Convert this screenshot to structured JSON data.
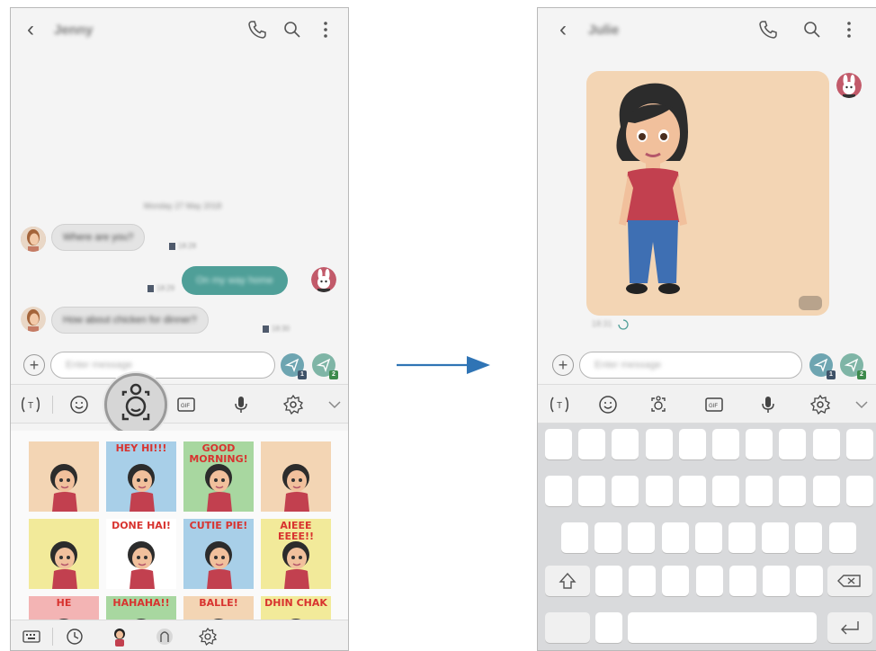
{
  "colors": {
    "accent_teal": "#4f9f98",
    "sticker_peach": "#f3d5b4",
    "arrow_blue": "#2f74b5"
  },
  "left_screen": {
    "contact_name": "Jenny",
    "date_label": "Monday 27 May 2018",
    "messages": [
      {
        "text": "Where are you?",
        "time": "18:28",
        "direction": "incoming"
      },
      {
        "text": "On my way home",
        "time": "18:29",
        "direction": "outgoing"
      },
      {
        "text": "How about chicken for dinner?",
        "time": "18:30",
        "direction": "incoming"
      }
    ],
    "input_placeholder": "Enter message",
    "send_sim1": "1",
    "send_sim2": "2",
    "stickers": [
      {
        "caption": "",
        "bg": "#f3d5b4"
      },
      {
        "caption": "HEY HI!!!",
        "bg": "#a8cfe8"
      },
      {
        "caption": "GOOD MORNING!",
        "bg": "#a8d7a0"
      },
      {
        "caption": "",
        "bg": "#f3d5b4"
      },
      {
        "caption": "",
        "bg": "#f2ea9a"
      },
      {
        "caption": "DONE HAI!",
        "bg": "#ffffff"
      },
      {
        "caption": "CUTIE PIE!",
        "bg": "#a8cfe8"
      },
      {
        "caption": "AIEEE EEEE!!",
        "bg": "#f2ea9a"
      },
      {
        "caption": "HE",
        "bg": "#f3b4b4"
      },
      {
        "caption": "HAHAHA!!",
        "bg": "#a8d7a0"
      },
      {
        "caption": "BALLE!",
        "bg": "#f3d5b4"
      },
      {
        "caption": "DHIN CHAK",
        "bg": "#f2ea9a"
      }
    ]
  },
  "right_screen": {
    "contact_name": "Julie",
    "sticker_time": "18:31",
    "input_placeholder": "Enter message",
    "send_sim1": "1",
    "send_sim2": "2"
  }
}
